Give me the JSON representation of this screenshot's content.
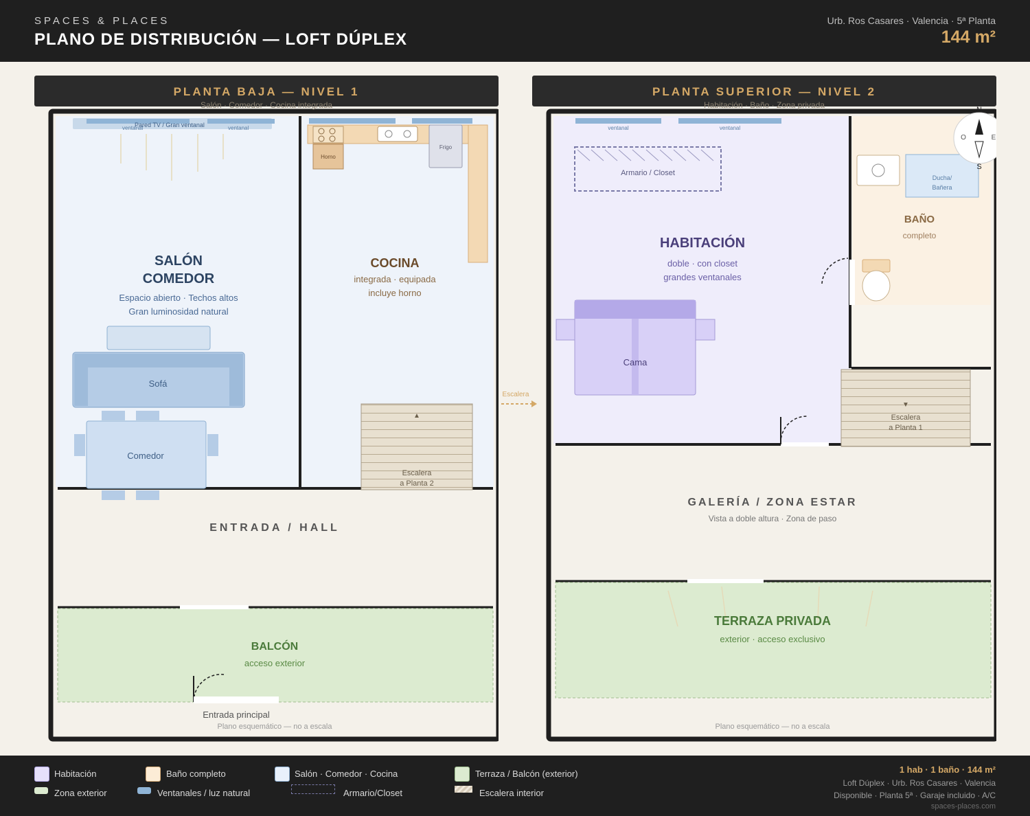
{
  "header": {
    "brand": "SPACES & PLACES",
    "title": "PLANO DE DISTRIBUCIÓN — LOFT DÚPLEX",
    "address": "Urb. Ros Casares · Valencia · 5ª Planta",
    "area": "144 m²"
  },
  "level1": {
    "title": "PLANTA BAJA — NIVEL 1",
    "subtitle": "Salón · Comedor · Cocina integrada",
    "window_left": "ventanal",
    "window_tv": "Pared TV / Gran ventanal",
    "window_right": "ventanal",
    "salon_title_1": "SALÓN",
    "salon_title_2": "COMEDOR",
    "salon_desc_1": "Espacio abierto · Techos altos",
    "salon_desc_2": "Gran luminosidad natural",
    "sofa": "Sofá",
    "dining": "Comedor",
    "kitchen_title": "COCINA",
    "kitchen_desc_1": "integrada · equipada",
    "kitchen_desc_2": "incluye horno",
    "oven": "Horno",
    "fridge": "Frigo",
    "stairs_1": "Escalera",
    "stairs_2": "a Planta 2",
    "stairs_arrow": "▲",
    "hall": "ENTRADA / HALL",
    "balcony_title": "BALCÓN",
    "balcony_desc": "acceso exterior",
    "entrance": "Entrada principal",
    "note": "Plano esquemático — no a escala"
  },
  "connector": "Escalera",
  "level2": {
    "title": "PLANTA SUPERIOR — NIVEL 2",
    "subtitle": "Habitación · Baño · Zona privada",
    "window_left": "ventanal",
    "window_right": "ventanal",
    "closet": "Armario / Closet",
    "room_title": "HABITACIÓN",
    "room_desc_1": "doble · con closet",
    "room_desc_2": "grandes ventanales",
    "bed": "Cama",
    "bath_title": "BAÑO",
    "bath_desc": "completo",
    "shower_1": "Ducha/",
    "shower_2": "Bañera",
    "stairs_arrow": "▼",
    "stairs_1": "Escalera",
    "stairs_2": "a Planta 1",
    "gallery_title": "GALERÍA / ZONA ESTAR",
    "gallery_desc": "Vista a doble altura · Zona de paso",
    "terrace_title": "TERRAZA PRIVADA",
    "terrace_desc": "exterior · acceso exclusivo",
    "compass": {
      "n": "N",
      "s": "S",
      "e": "E",
      "w": "O"
    },
    "note": "Plano esquemático — no a escala"
  },
  "legend": [
    {
      "label": "Habitación",
      "color": "#e6e0fb"
    },
    {
      "label": "Baño completo",
      "color": "#fcecd6"
    },
    {
      "label": "Salón · Comedor · Cocina",
      "color": "#e8f0fb"
    },
    {
      "label": "Terraza / Balcón (exterior)",
      "color": "#dcebd0"
    },
    {
      "label": "Zona exterior",
      "color": "#dcebd0"
    },
    {
      "label": "Ventanales / luz natural",
      "color": "#8fb4d6"
    },
    {
      "label": "Armario/Closet",
      "color": "#7a7aa8"
    },
    {
      "label": "Escalera interior",
      "color": "#d6cbb8"
    }
  ],
  "footer": {
    "summary": "1 hab · 1 baño · 144 m²",
    "line1": "Loft Dúplex · Urb. Ros Casares · Valencia",
    "line2": "Disponible · Planta 5ª · Garaje incluido · A/C",
    "website": "spaces-places.com"
  }
}
